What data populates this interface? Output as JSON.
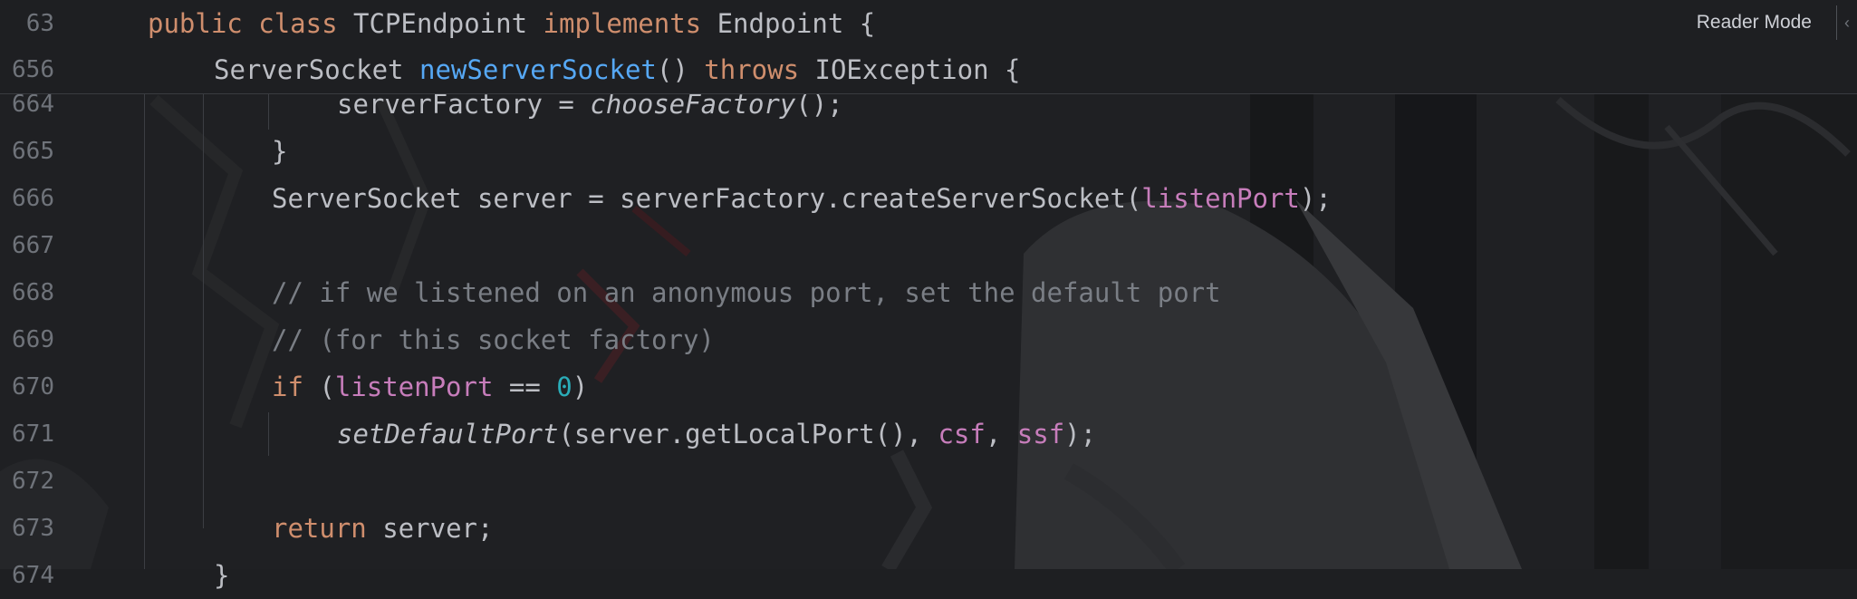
{
  "reader_mode_label": "Reader Mode",
  "sticky": [
    {
      "n": "63",
      "indent": 0,
      "tokens": [
        {
          "t": "public",
          "c": "kw"
        },
        {
          "t": " "
        },
        {
          "t": "class",
          "c": "kw"
        },
        {
          "t": " TCPEndpoint "
        },
        {
          "t": "implements",
          "c": "kw"
        },
        {
          "t": " Endpoint {"
        }
      ]
    },
    {
      "n": "656",
      "indent": 1,
      "tokens": [
        {
          "t": "ServerSocket "
        },
        {
          "t": "newServerSocket",
          "c": "fn"
        },
        {
          "t": "() "
        },
        {
          "t": "throws",
          "c": "kw"
        },
        {
          "t": " IOException {"
        }
      ]
    }
  ],
  "lines": [
    {
      "n": "664",
      "indent": 3,
      "tokens": [
        {
          "t": "serverFactory = "
        },
        {
          "t": "chooseFactory",
          "c": "it"
        },
        {
          "t": "();"
        }
      ]
    },
    {
      "n": "665",
      "indent": 2,
      "tokens": [
        {
          "t": "}"
        }
      ]
    },
    {
      "n": "666",
      "indent": 2,
      "tokens": [
        {
          "t": "ServerSocket server = serverFactory.createServerSocket("
        },
        {
          "t": "listenPort",
          "c": "fld"
        },
        {
          "t": ");"
        }
      ]
    },
    {
      "n": "667",
      "indent": 2,
      "tokens": []
    },
    {
      "n": "668",
      "indent": 2,
      "tokens": [
        {
          "t": "// if we listened on an anonymous port, set the default port",
          "c": "cmt"
        }
      ]
    },
    {
      "n": "669",
      "indent": 2,
      "tokens": [
        {
          "t": "// (for this socket factory)",
          "c": "cmt"
        }
      ]
    },
    {
      "n": "670",
      "indent": 2,
      "tokens": [
        {
          "t": "if",
          "c": "kw"
        },
        {
          "t": " ("
        },
        {
          "t": "listenPort",
          "c": "fld"
        },
        {
          "t": " == "
        },
        {
          "t": "0",
          "c": "num"
        },
        {
          "t": ")"
        }
      ]
    },
    {
      "n": "671",
      "indent": 3,
      "tokens": [
        {
          "t": "setDefaultPort",
          "c": "it"
        },
        {
          "t": "(server.getLocalPort(), "
        },
        {
          "t": "csf",
          "c": "fld"
        },
        {
          "t": ", "
        },
        {
          "t": "ssf",
          "c": "fld"
        },
        {
          "t": ");"
        }
      ]
    },
    {
      "n": "672",
      "indent": 2,
      "tokens": []
    },
    {
      "n": "673",
      "indent": 2,
      "tokens": [
        {
          "t": "return",
          "c": "kw"
        },
        {
          "t": " server;"
        }
      ]
    },
    {
      "n": "674",
      "indent": 1,
      "tokens": [
        {
          "t": "}"
        }
      ]
    }
  ]
}
